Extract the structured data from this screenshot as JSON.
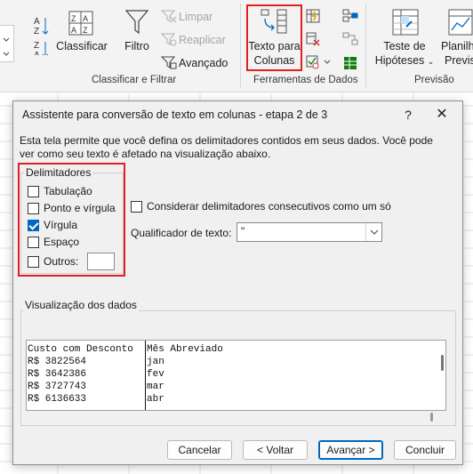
{
  "ribbon": {
    "sort_filter": {
      "sort_button_label": "Classificar",
      "filter_button_label": "Filtro",
      "clear_label": "Limpar",
      "reapply_label": "Reaplicar",
      "advanced_label": "Avançado",
      "group_label": "Classificar e Filtrar"
    },
    "data_tools": {
      "text_to_columns_line1": "Texto para",
      "text_to_columns_line2": "Colunas",
      "group_label": "Ferramentas de Dados"
    },
    "forecast": {
      "what_if_line1": "Teste de",
      "what_if_line2": "Hipóteses",
      "forecast_sheet_line1": "Planilha",
      "forecast_sheet_line2": "Previs",
      "group_label": "Previsão"
    },
    "colors": {
      "accent": "#0067c0",
      "highlight": "#e0201f",
      "disabled": "#a6a6a6"
    }
  },
  "dialog": {
    "title": "Assistente para conversão de texto em colunas - etapa 2 de 3",
    "help": "?",
    "close": "✕",
    "description": "Esta tela permite que você defina os delimitadores contidos em seus dados. Você pode ver como seu texto é afetado na visualização abaixo.",
    "delimiters": {
      "legend": "Delimitadores",
      "tab": {
        "label": "Tabulação",
        "checked": false
      },
      "semicolon": {
        "label": "Ponto e vírgula",
        "checked": false
      },
      "comma": {
        "label": "Vírgula",
        "checked": true
      },
      "space": {
        "label": "Espaço",
        "checked": false
      },
      "other": {
        "label": "Outros:",
        "checked": false,
        "value": ""
      }
    },
    "consecutive": {
      "label": "Considerar delimitadores consecutivos como um só",
      "checked": false
    },
    "qualifier": {
      "label": "Qualificador de texto:",
      "value": "\""
    },
    "preview": {
      "legend": "Visualização dos dados",
      "rows": [
        [
          "Custo com Desconto",
          "Mês Abreviado"
        ],
        [
          "R$ 3822564",
          "jan"
        ],
        [
          "R$ 3642386",
          "fev"
        ],
        [
          "R$ 3727743",
          "mar"
        ],
        [
          "R$ 6136633",
          "abr"
        ]
      ]
    },
    "buttons": {
      "cancel": "Cancelar",
      "back": "< Voltar",
      "next": "Avançar >",
      "finish": "Concluir"
    }
  }
}
